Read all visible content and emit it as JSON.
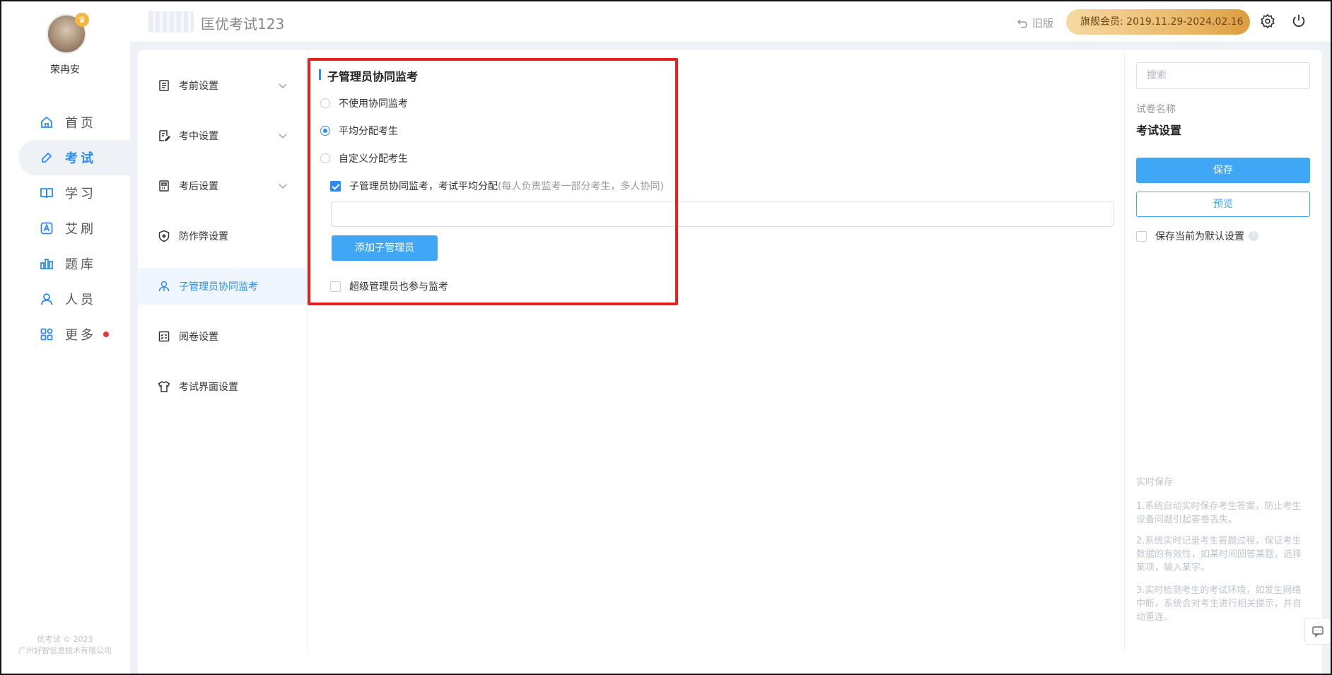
{
  "user": {
    "name": "荣冉安"
  },
  "nav": {
    "items": [
      {
        "label": "首页",
        "icon": "home-icon"
      },
      {
        "label": "考试",
        "icon": "pencil-tag-icon",
        "active": true
      },
      {
        "label": "学习",
        "icon": "book-icon"
      },
      {
        "label": "艾刷",
        "icon": "letter-a-icon"
      },
      {
        "label": "题库",
        "icon": "bar-chart-icon"
      },
      {
        "label": "人员",
        "icon": "person-icon"
      },
      {
        "label": "更多",
        "icon": "apps-icon",
        "has_dot": true
      }
    ],
    "copyright_line1": "优考试 © 2023",
    "copyright_line2": "广州好智信息技术有限公司"
  },
  "header": {
    "app_title": "匡优考试123",
    "old_version": "旧版",
    "vip_badge": "旗舰会员: 2019.11.29-2024.02.16"
  },
  "submenu": {
    "items": [
      {
        "label": "考前设置",
        "icon": "doc-list-icon",
        "expandable": true
      },
      {
        "label": "考中设置",
        "icon": "doc-edit-icon",
        "expandable": true
      },
      {
        "label": "考后设置",
        "icon": "doc-calc-icon",
        "expandable": true
      },
      {
        "label": "防作弊设置",
        "icon": "shield-plus-icon",
        "expandable": false
      },
      {
        "label": "子管理员协同监考",
        "icon": "admin-person-icon",
        "expandable": false,
        "active": true
      },
      {
        "label": "阅卷设置",
        "icon": "grading-icon",
        "expandable": false
      },
      {
        "label": "考试界面设置",
        "icon": "tshirt-icon",
        "expandable": false
      }
    ]
  },
  "content": {
    "section_title": "子管理员协同监考",
    "options": [
      {
        "label": "不使用协同监考",
        "selected": false
      },
      {
        "label": "平均分配考生",
        "selected": true
      },
      {
        "label": "自定义分配考生",
        "selected": false
      }
    ],
    "sub_check_label": "子管理员协同监考，考试平均分配",
    "sub_check_hint": "(每人负责监考一部分考生，多人协同)",
    "sub_check_checked": true,
    "admin_input_value": "",
    "add_admin_button": "添加子管理员",
    "super_admin_label": "超级管理员也参与监考",
    "super_admin_checked": false
  },
  "rightpanel": {
    "search_placeholder": "搜索",
    "paper_label": "试卷名称",
    "paper_name": "考试设置",
    "save_button": "保存",
    "preview_button": "预览",
    "default_label": "保存当前为默认设置",
    "realtime_title": "实时保存",
    "realtime_notes": [
      "1.系统自动实时保存考生答案，防止考生设备问题引起答卷丢失。",
      "2.系统实时记录考生答题过程，保证考生数据的有效性，如某时间回答某题，选择某项，输入某字。",
      "3.实时检测考生的考试环境，如发生网络中断，系统会对考生进行相关提示，并自动重连。"
    ]
  },
  "colors": {
    "accent": "#2b8cf6",
    "button_blue": "#3fa7f6",
    "highlight_red": "#e8201c",
    "vip_gold": "#e9b663"
  }
}
